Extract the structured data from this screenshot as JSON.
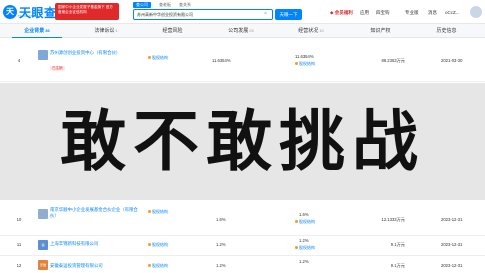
{
  "header": {
    "logo_mark": "天",
    "logo_text": "天眼查",
    "logo_sub": "TianYanCha.com",
    "badge_text": "国家中小企业发展子基金旗下 官方备案企业征信机构",
    "search_tabs": [
      {
        "label": "查公司",
        "active": true
      },
      {
        "label": "查老板",
        "active": false
      },
      {
        "label": "查关系",
        "active": false
      }
    ],
    "search_value": "苏州高新中华创业投资有限公司",
    "search_clear": "×",
    "search_button": "天眼一下",
    "vip": "会员福利",
    "app": "应用",
    "sibao": "四宝钩",
    "edition": "专业版",
    "messages": "消息",
    "user": "oCcZ..."
  },
  "tabs": [
    {
      "label": "企业背景",
      "count": "36",
      "active": true
    },
    {
      "label": "法律诉讼",
      "count": "1",
      "active": false
    },
    {
      "label": "经营风险",
      "count": "",
      "active": false
    },
    {
      "label": "公司发展",
      "count": "25",
      "active": false
    },
    {
      "label": "经营状况",
      "count": "10",
      "active": false
    },
    {
      "label": "知识产权",
      "count": "",
      "active": false
    },
    {
      "label": "历史信息",
      "count": "",
      "active": false
    }
  ],
  "rows": [
    {
      "index": "4",
      "logo_char": "",
      "logo_color": "#7fa8d6",
      "name": "苏州源创创业投资中心（有限合伙）",
      "tag": "已注销",
      "equity": "股权结构",
      "ratio": "11.6354%",
      "sub_ratio": "11.6354%",
      "sub_equity": "股权结构",
      "amount": "88.2353万元",
      "date": "2021-03-30"
    },
    {
      "index": "10",
      "logo_char": "",
      "logo_color": "#8faed0",
      "name": "南京华顺中小企业发展基金合伙企业（有限合伙）",
      "tag": "",
      "equity": "股权结构",
      "ratio": "1.6%",
      "sub_ratio": "1.6%",
      "sub_equity": "股权结构",
      "amount": "12.1333万元",
      "date": "2023-12-31"
    },
    {
      "index": "11",
      "logo_char": "锦",
      "logo_color": "#5b8fd4",
      "name": "上海丰锦新科技有限公司",
      "tag": "",
      "equity": "股权结构",
      "ratio": "1.2%",
      "sub_ratio": "1.2%",
      "sub_equity": "股权结构",
      "amount": "9.1万元",
      "date": "2023-12-31"
    },
    {
      "index": "12",
      "logo_char": "安徽",
      "logo_color": "#e0843a",
      "name": "安徽泰运投资管理有限公司",
      "tag": "",
      "equity": "股权结构",
      "ratio": "1.2%",
      "sub_ratio": "1.2%",
      "sub_equity": "",
      "amount": "9.1万元",
      "date": "2023-12-31"
    }
  ],
  "watermark": "敢不敢挑战"
}
